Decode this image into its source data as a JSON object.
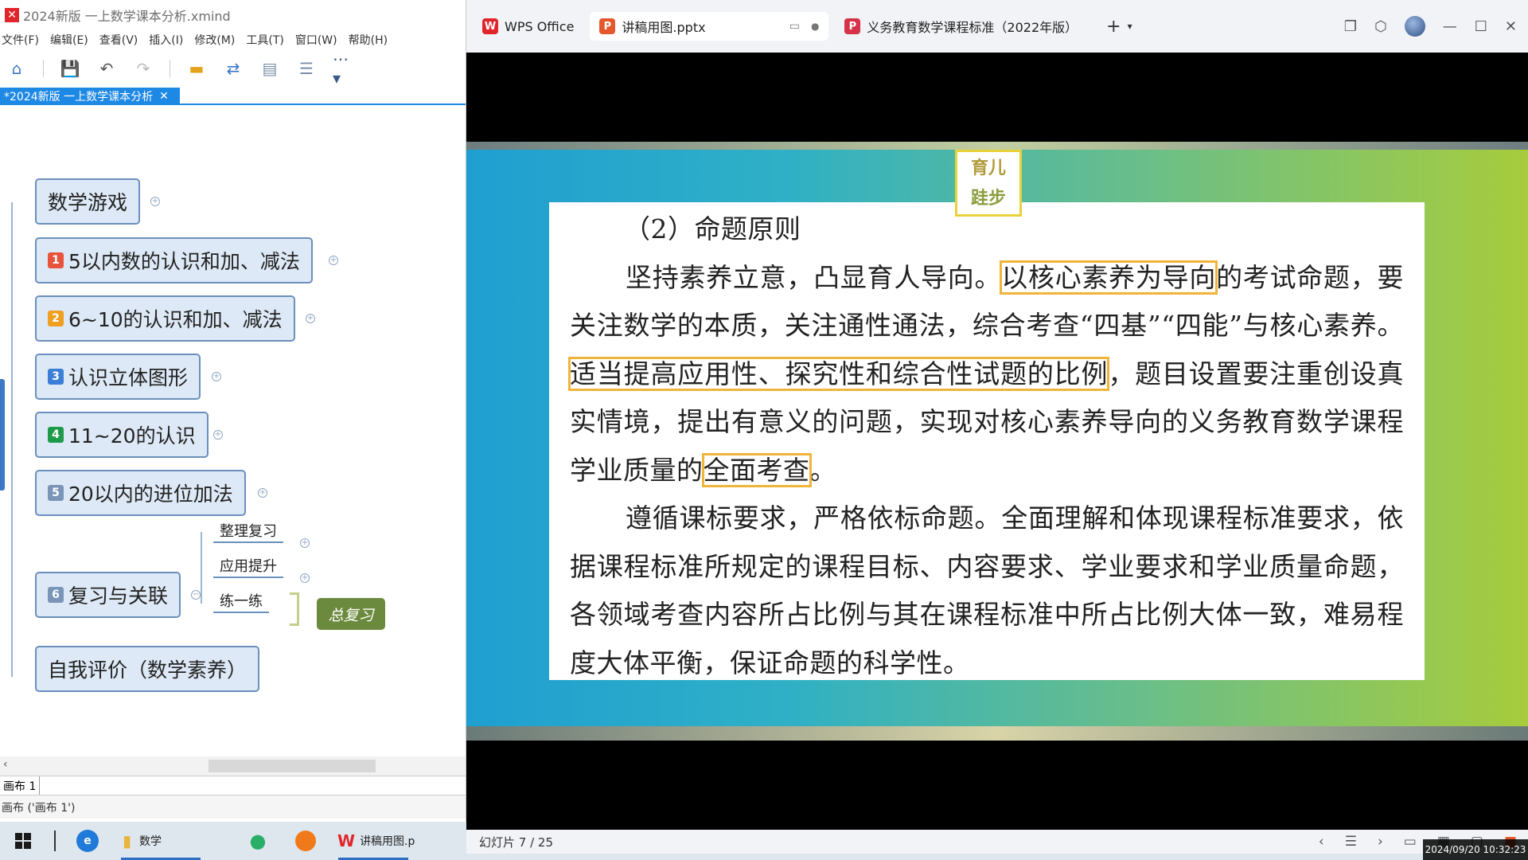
{
  "xmind": {
    "title": "2024新版 一上数学课本分析.xmind",
    "menu": [
      "文件(F)",
      "编辑(E)",
      "查看(V)",
      "插入(I)",
      "修改(M)",
      "工具(T)",
      "窗口(W)",
      "帮助(H)"
    ],
    "doc_tab": "*2024新版 一上数学课本分析",
    "topics": [
      {
        "num": "",
        "num_color": "",
        "label": "数学游戏"
      },
      {
        "num": "1",
        "num_color": "#e8543b",
        "label": "5以内数的认识和加、减法"
      },
      {
        "num": "2",
        "num_color": "#f0a020",
        "label": "6~10的认识和加、减法"
      },
      {
        "num": "3",
        "num_color": "#3b7fd6",
        "label": "认识立体图形"
      },
      {
        "num": "4",
        "num_color": "#1e9b4a",
        "label": "11~20的认识"
      },
      {
        "num": "5",
        "num_color": "#7a95b8",
        "label": "20以内的进位加法"
      },
      {
        "num": "6",
        "num_color": "#7a95b8",
        "label": "复习与关联"
      },
      {
        "num": "",
        "num_color": "",
        "label": "自我评价（数学素养）"
      }
    ],
    "subtopics": [
      "整理复习",
      "应用提升",
      "练一练"
    ],
    "summary": "总复习",
    "sheet_tab": "画布 1",
    "status": "画布 ('画布 1')"
  },
  "wps": {
    "tabs": [
      {
        "label": "WPS Office",
        "icon": "wps-logo-icon",
        "color": "#e0262b"
      },
      {
        "label": "讲稿用图.pptx",
        "icon": "pptx-icon",
        "color": "#e5572c"
      },
      {
        "label": "义务教育数学课程标准（2022年版）",
        "icon": "pdf-icon",
        "color": "#d6334a"
      }
    ],
    "slide": {
      "logo_line1": "育儿",
      "logo_line2": "跬步",
      "heading": "（2）命题原则",
      "p1_a": "坚持素养立意，凸显育人导向。",
      "p1_hl1": "以核心素养为导向",
      "p1_b": "的考试命题，要关注数学的本质，关注通性通法，综合考查“四基”“四能”与核心素养。",
      "p1_hl2": "适当提高应用性、探究性和综合性试题的比例",
      "p1_c": "，题目设置要注重创设真实情境，提出有意义的问题，实现对核心素养导向的义务教育数学课程学业质量的",
      "p1_hl3": "全面考查",
      "p1_d": "。",
      "p2": "遵循课标要求，严格依标命题。全面理解和体现课程标准要求，依据课程标准所规定的课程目标、内容要求、学业要求和学业质量命题，各领域考查内容所占比例与其在课程标准中所占比例大体一致，难易程度大体平衡，保证命题的科学性。"
    },
    "status": "幻灯片 7 / 25"
  },
  "taskbar": {
    "folder_label": "数学",
    "wps_label": "讲稿用图.p",
    "clock": "2024/09/20 10:32:23"
  }
}
